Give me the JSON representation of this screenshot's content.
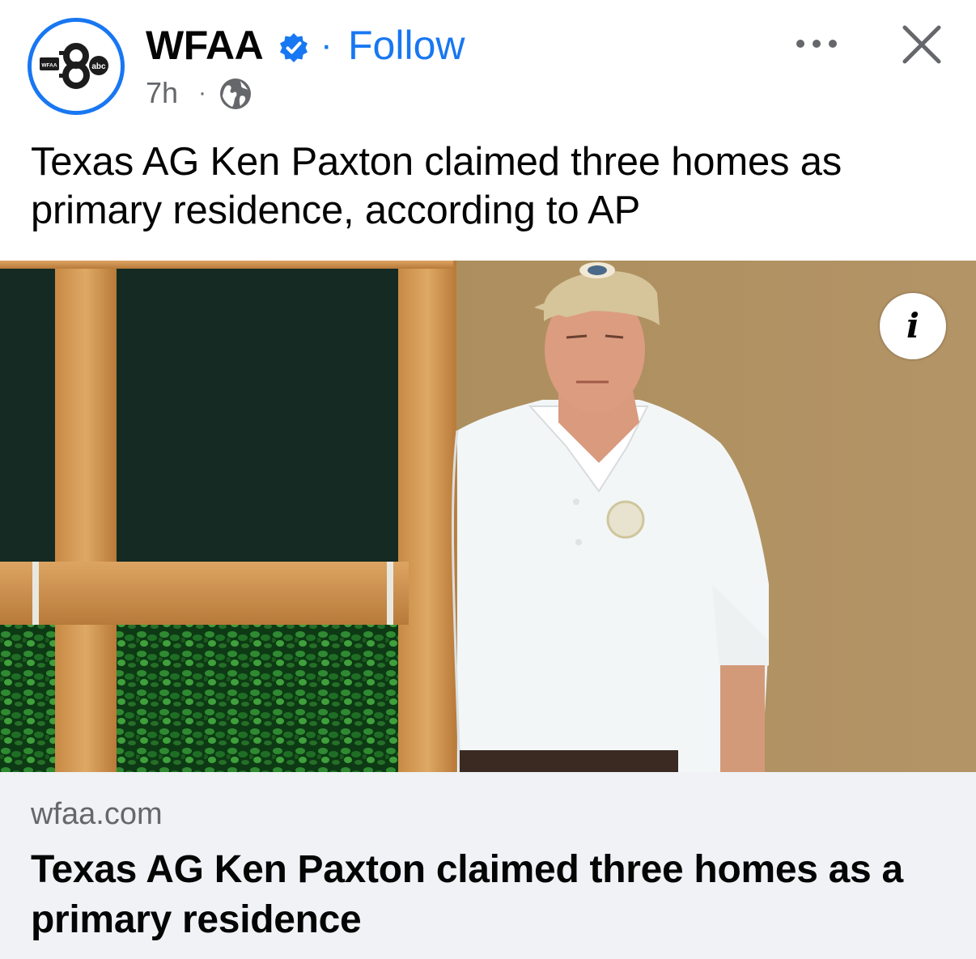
{
  "header": {
    "page_name": "WFAA",
    "separator": "·",
    "follow_label": "Follow",
    "timestamp": "7h",
    "timestamp_separator": "·",
    "audience_icon": "globe-icon",
    "more_icon": "more-options-icon",
    "close_icon": "close-icon",
    "verified_icon": "verified-badge-icon"
  },
  "avatar": {
    "logo_text_small": "WFAA",
    "logo_text_abc": "abc"
  },
  "post": {
    "caption": "Texas AG Ken Paxton claimed three homes as primary residence, according to AP"
  },
  "link": {
    "domain": "wfaa.com",
    "title": "Texas AG Ken Paxton claimed three homes as a primary residence",
    "info_label": "i"
  },
  "colors": {
    "accent": "#1877f2",
    "secondary_text": "#65676b",
    "primary_text": "#050505",
    "preview_bg": "#f0f2f5"
  }
}
